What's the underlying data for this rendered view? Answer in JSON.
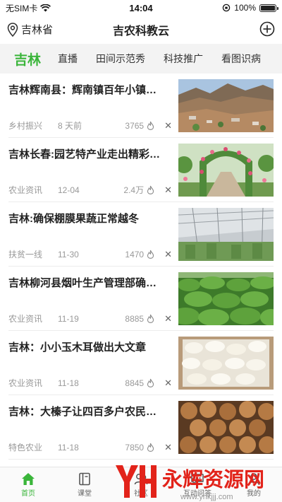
{
  "status": {
    "carrier": "无SIM卡",
    "time": "14:04",
    "battery": "100%",
    "battery_level": 1.0
  },
  "header": {
    "location": "吉林省",
    "title": "吉农科教云"
  },
  "tabs": [
    {
      "label": "吉林",
      "active": true
    },
    {
      "label": "直播"
    },
    {
      "label": "田间示范秀"
    },
    {
      "label": "科技推广"
    },
    {
      "label": "看图识病"
    }
  ],
  "feed": [
    {
      "title": "吉林辉南县：辉南镇百年小镇…",
      "category": "乡村振兴",
      "date": "8 天前",
      "hot": "3765"
    },
    {
      "title": "吉林长春:园艺特产业走出精彩…",
      "category": "农业资讯",
      "date": "12-04",
      "hot": "2.4万"
    },
    {
      "title": "吉林:确保棚膜果蔬正常越冬",
      "category": "扶贫一线",
      "date": "11-30",
      "hot": "1470"
    },
    {
      "title": "吉林柳河县烟叶生产管理部确…",
      "category": "农业资讯",
      "date": "11-19",
      "hot": "8885"
    },
    {
      "title": "吉林：小小玉木耳做出大文章",
      "category": "农业资讯",
      "date": "11-18",
      "hot": "8845"
    },
    {
      "title": "吉林：大榛子让四百多户农民…",
      "category": "特色农业",
      "date": "11-18",
      "hot": "7850"
    }
  ],
  "tabbar": [
    {
      "label": "首页",
      "icon": "home-icon",
      "active": true
    },
    {
      "label": "课堂",
      "icon": "book-icon"
    },
    {
      "label": "社区",
      "icon": "community-icon"
    },
    {
      "label": "互动问答",
      "icon": "chat-icon"
    },
    {
      "label": "我的",
      "icon": "user-icon"
    }
  ],
  "watermark": {
    "text": "永辉资源网",
    "url": "www.yhkjjj.com"
  },
  "colors": {
    "accent": "#3ab53a",
    "watermark_red": "#e2231a"
  }
}
